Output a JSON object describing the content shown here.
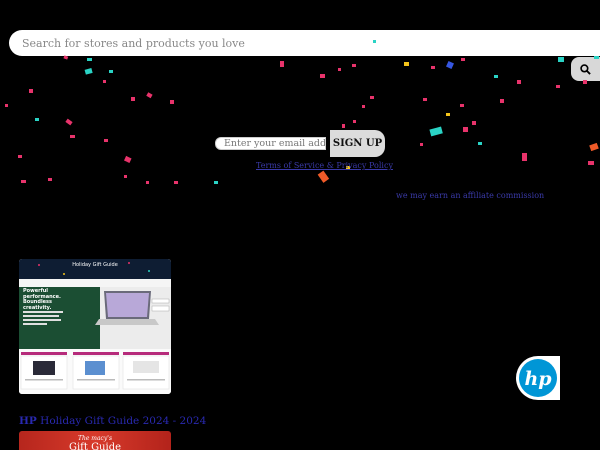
{
  "search": {
    "placeholder": "Search for stores and products you love",
    "button_icon": "search-icon"
  },
  "newsletter": {
    "email_placeholder": "Enter your email addr",
    "signup_label": "SIGN UP",
    "terms_text": "Terms of Service & Privacy Policy"
  },
  "affiliate_text": "we may earn an affiliate commission",
  "cards": [
    {
      "thumbnail": {
        "header": "Holiday Gift Guide",
        "headline_1": "Powerful",
        "headline_2": "performance.",
        "headline_3": "Boundless",
        "headline_4": "creativity."
      },
      "brand_logo": "hp-logo",
      "brand": "HP",
      "title": "Holiday Gift Guide 2024 - 2024"
    },
    {
      "thumbnail": {
        "brand": "The macy's",
        "header": "Gift Guide"
      }
    }
  ],
  "colors": {
    "background": "#000000",
    "link": "#3a3aa8",
    "title_link": "#2929b0",
    "macys_red": "#c8281f",
    "hp_blue": "#0096d6"
  }
}
